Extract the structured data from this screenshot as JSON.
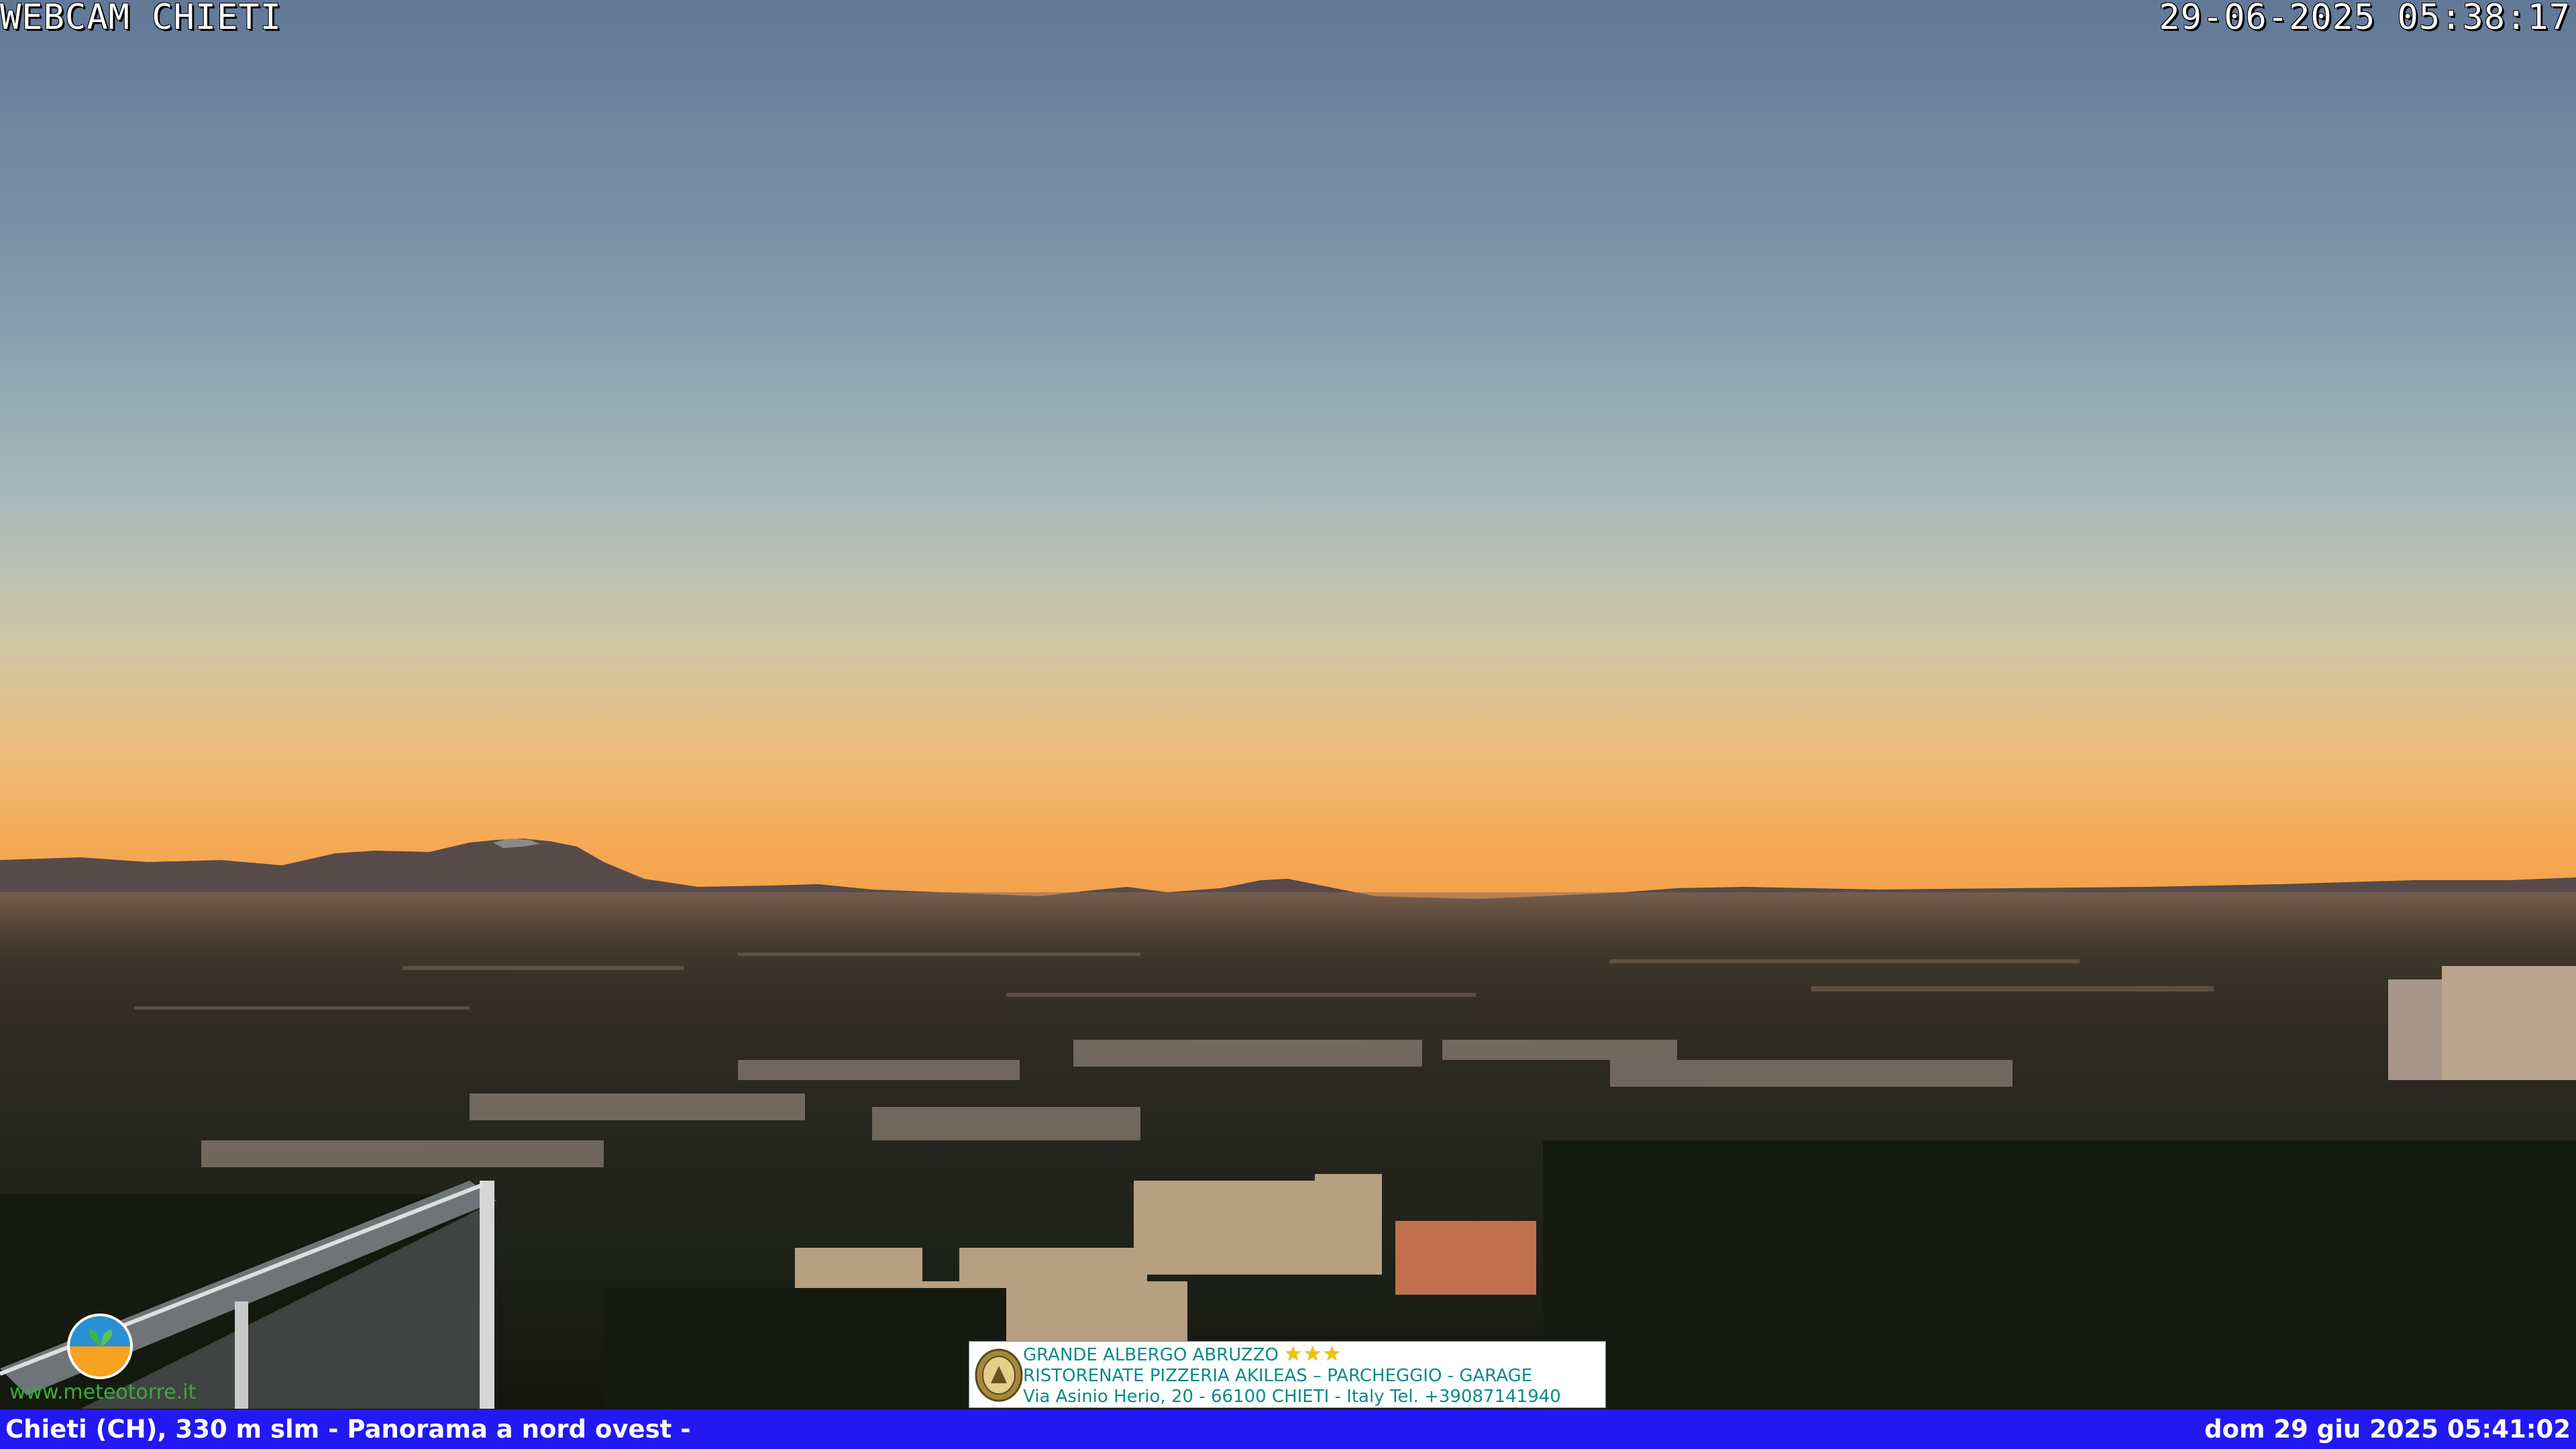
{
  "overlay": {
    "title": "WEBCAM CHIETI",
    "capture_time": "29-06-2025 05:38:17"
  },
  "bottom_bar": {
    "caption": "Chieti (CH), 330 m slm - Panorama a nord ovest -",
    "timestamp": "dom 29 giu 2025 05:41:02",
    "color": "#2218f2"
  },
  "logo": {
    "site": "www.meteotorre.it",
    "icon": "weather-logo-icon"
  },
  "advertisement": {
    "line1": "GRANDE ALBERGO ABRUZZO",
    "stars": "★★★",
    "line2": "RISTORENATE PIZZERIA AKILEAS – PARCHEGGIO - GARAGE",
    "line3": "Via Asinio Herio, 20 - 66100 CHIETI - Italy Tel. +39087141940",
    "icon": "hotel-emblem-icon"
  },
  "colors": {
    "sky_top": "#627a98",
    "sky_mid": "#a5b8bd",
    "horizon": "#f2a24a",
    "ground": "#1b1a14"
  }
}
